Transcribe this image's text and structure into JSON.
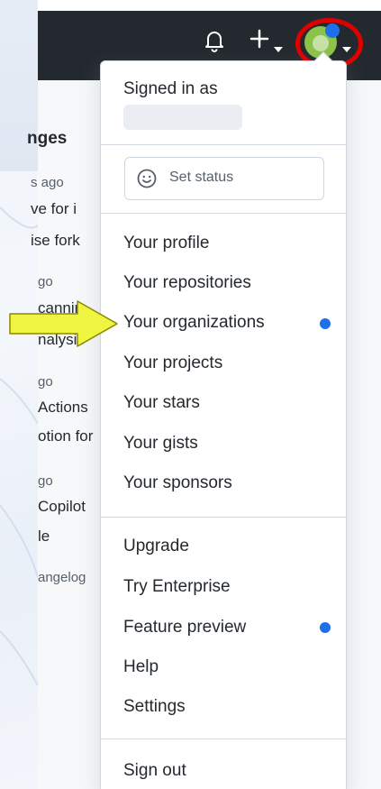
{
  "header": {
    "icons": {
      "notifications": "bell-icon",
      "create": "plus-icon",
      "caret": "caret-down-icon"
    },
    "colors": {
      "bar": "#24292f",
      "highlight": "#e00000"
    }
  },
  "background": {
    "title": "nges",
    "items": [
      {
        "time": "s ago",
        "lines": [
          "ve for i",
          "ise fork"
        ]
      },
      {
        "time": "go",
        "lines": [
          "cannin",
          "nalysis"
        ]
      },
      {
        "time": "go",
        "lines": [
          "Actions",
          "otion for"
        ]
      },
      {
        "time": "go",
        "lines": [
          "Copilot",
          "le"
        ]
      }
    ],
    "link": "angelog"
  },
  "menu": {
    "signed_in_label": "Signed in as",
    "set_status_label": "Set status",
    "section1": [
      {
        "label": "Your profile",
        "dot": false
      },
      {
        "label": "Your repositories",
        "dot": false
      },
      {
        "label": "Your organizations",
        "dot": true
      },
      {
        "label": "Your projects",
        "dot": false
      },
      {
        "label": "Your stars",
        "dot": false
      },
      {
        "label": "Your gists",
        "dot": false
      },
      {
        "label": "Your sponsors",
        "dot": false
      }
    ],
    "section2": [
      {
        "label": "Upgrade",
        "dot": false
      },
      {
        "label": "Try Enterprise",
        "dot": false
      },
      {
        "label": "Feature preview",
        "dot": true
      },
      {
        "label": "Help",
        "dot": false
      },
      {
        "label": "Settings",
        "dot": false
      }
    ],
    "sign_out_label": "Sign out",
    "colors": {
      "accent_dot": "#1f6feb",
      "arrow": "#f0f542"
    }
  }
}
